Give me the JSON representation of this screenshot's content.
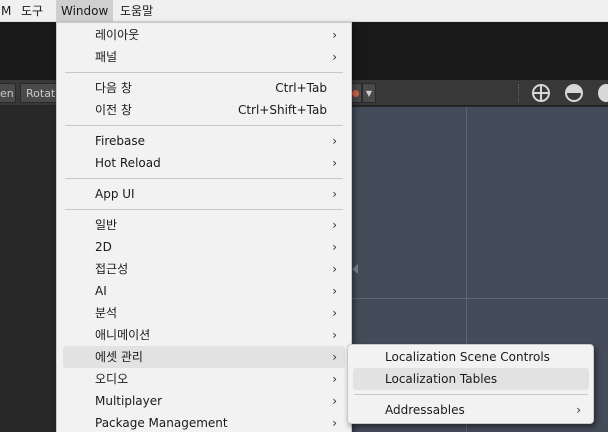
{
  "menubar": {
    "items": [
      {
        "label": "M"
      },
      {
        "label": "도구"
      },
      {
        "label": "Window",
        "active": true
      },
      {
        "label": "도움말"
      }
    ]
  },
  "toolbar": {
    "left_tools": [
      "en",
      "Rotat"
    ],
    "dropdown_icon": "chevron-down-icon",
    "right_icons": [
      "globe-wireframe-icon",
      "globe-shaded-icon",
      "globe-solid-icon"
    ]
  },
  "window_menu": {
    "items": [
      {
        "label": "레이아웃",
        "submenu": true
      },
      {
        "label": "패널",
        "submenu": true
      },
      {
        "label": "다음 창",
        "shortcut": "Ctrl+Tab"
      },
      {
        "label": "이전 창",
        "shortcut": "Ctrl+Shift+Tab"
      },
      {
        "label": "Firebase",
        "submenu": true
      },
      {
        "label": "Hot Reload",
        "submenu": true
      },
      {
        "label": "App UI",
        "submenu": true
      },
      {
        "label": "일반",
        "submenu": true
      },
      {
        "label": "2D",
        "submenu": true
      },
      {
        "label": "접근성",
        "submenu": true
      },
      {
        "label": "AI",
        "submenu": true
      },
      {
        "label": "분석",
        "submenu": true
      },
      {
        "label": "애니메이션",
        "submenu": true
      },
      {
        "label": "에셋 관리",
        "submenu": true,
        "highlighted": true
      },
      {
        "label": "오디오",
        "submenu": true
      },
      {
        "label": "Multiplayer",
        "submenu": true
      },
      {
        "label": "Package Management",
        "submenu": true
      }
    ],
    "arrow_glyph": "›"
  },
  "asset_submenu": {
    "items": [
      {
        "label": "Localization Scene Controls"
      },
      {
        "label": "Localization Tables",
        "highlighted": true
      },
      {
        "label": "Addressables",
        "submenu": true
      }
    ]
  },
  "colors": {
    "menu_bg": "#f2f2f2",
    "highlight": "#e2e2e2",
    "editor_dark": "#191919",
    "toolbar": "#383838",
    "scene_view": "#444b59"
  }
}
